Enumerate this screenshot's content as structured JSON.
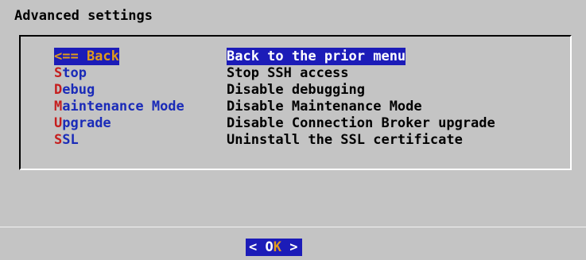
{
  "dialog": {
    "title": "Advanced settings"
  },
  "menu": {
    "items": [
      {
        "tag_hot": "",
        "tag_rest": "<== Back",
        "description": "Back to the prior menu",
        "selected": true
      },
      {
        "tag_hot": "S",
        "tag_rest": "top",
        "description": "Stop SSH access",
        "selected": false
      },
      {
        "tag_hot": "D",
        "tag_rest": "ebug",
        "description": "Disable debugging",
        "selected": false
      },
      {
        "tag_hot": "M",
        "tag_rest": "aintenance Mode",
        "description": "Disable Maintenance Mode",
        "selected": false
      },
      {
        "tag_hot": "U",
        "tag_rest": "pgrade",
        "description": "Disable Connection Broker upgrade",
        "selected": false
      },
      {
        "tag_hot": "S",
        "tag_rest": "SL",
        "description": "Uninstall the SSL certificate",
        "selected": false
      }
    ]
  },
  "buttons": {
    "ok": {
      "left": "< ",
      "hot": "O",
      "highlight": "K",
      "right": " >"
    }
  },
  "colors": {
    "background": "#c4c4c4",
    "selection": "#1c1cb8",
    "hotkey": "#c51e1e",
    "tag": "#1a2bb8",
    "selected_tag": "#e09b1d"
  }
}
